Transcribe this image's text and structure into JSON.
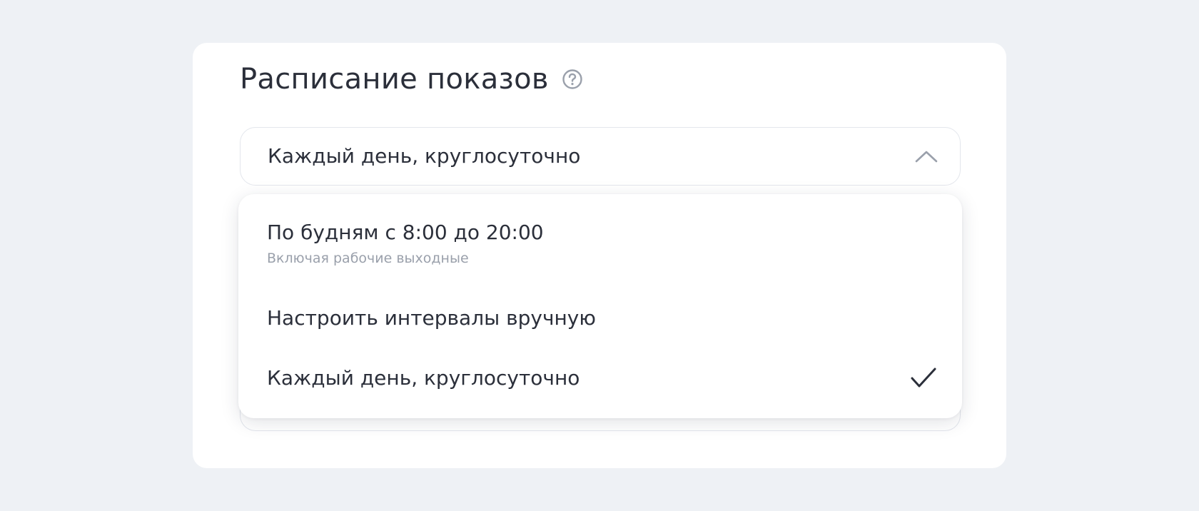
{
  "section": {
    "title": "Расписание показов",
    "help_icon": "question-circle-icon"
  },
  "schedule_select": {
    "value": "Каждый день, круглосуточно",
    "state": "expanded",
    "chevron_icon": "chevron-up-icon"
  },
  "dropdown": {
    "options": [
      {
        "label": "По будням с 8:00 до 20:00",
        "sublabel": "Включая рабочие выходные",
        "selected": false
      },
      {
        "label": "Настроить интервалы вручную",
        "selected": false
      },
      {
        "label": "Каждый день, круглосуточно",
        "selected": true,
        "check_icon": "checkmark-icon"
      }
    ]
  },
  "colors": {
    "page_background": "#eef1f5",
    "card_background": "#ffffff",
    "text_primary": "#2b2f3a",
    "text_secondary": "#9aa0ab",
    "border": "#e3e6ec",
    "icon_muted": "#9aa0ab"
  }
}
